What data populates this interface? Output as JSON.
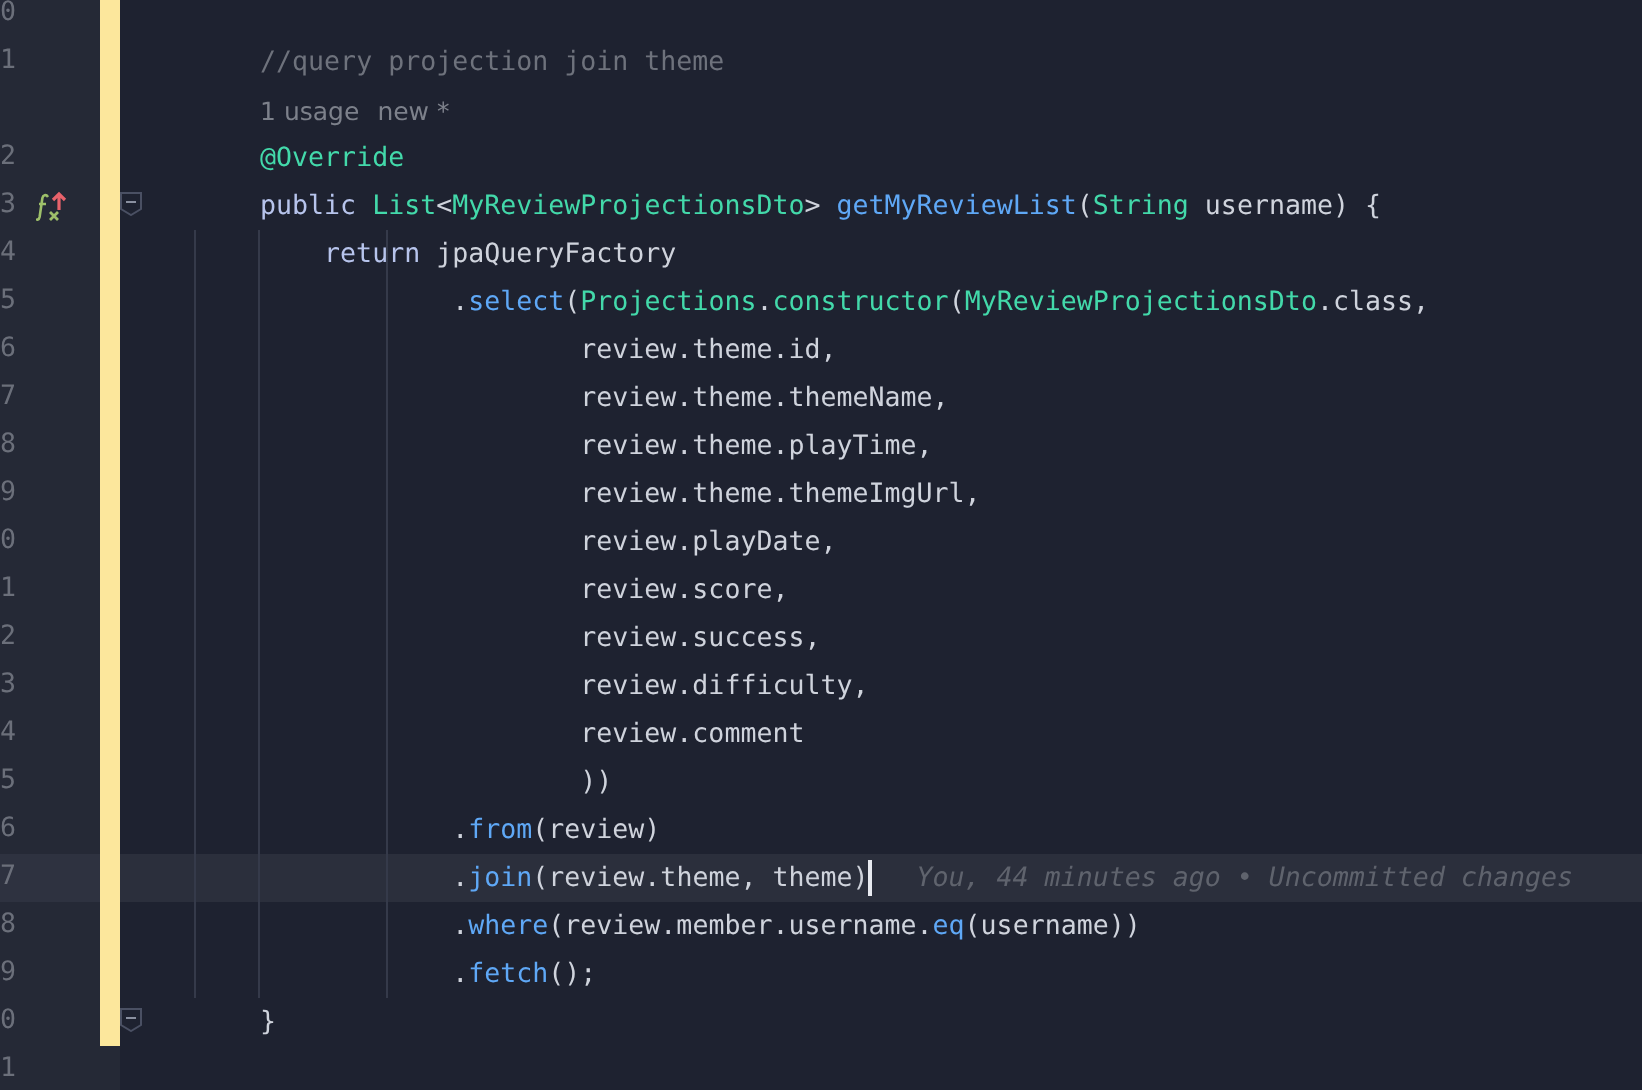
{
  "editor": {
    "lines": [
      {
        "kind": "code",
        "number": "0",
        "changed": true,
        "current": false,
        "fold": false,
        "overrides": false
      },
      {
        "kind": "code",
        "number": "1",
        "changed": true,
        "current": false,
        "fold": false,
        "overrides": false,
        "tokens": [
          {
            "kind": "comment",
            "text": "    //query projection join theme"
          }
        ]
      },
      {
        "kind": "hint",
        "changed": true,
        "current": false,
        "fold": false,
        "overrides": false,
        "parts": [
          "    1 usage",
          "new *"
        ]
      },
      {
        "kind": "code",
        "number": "2",
        "changed": true,
        "current": false,
        "fold": false,
        "overrides": false,
        "tokens": [
          {
            "kind": "annotation",
            "text": "    @Override"
          }
        ]
      },
      {
        "kind": "code",
        "number": "3",
        "changed": true,
        "current": false,
        "fold": true,
        "overrides": true,
        "tokens": [
          {
            "kind": "keyword",
            "text": "    public "
          },
          {
            "kind": "type",
            "text": "List"
          },
          {
            "kind": "plain",
            "text": "<"
          },
          {
            "kind": "type",
            "text": "MyReviewProjectionsDto"
          },
          {
            "kind": "plain",
            "text": "> "
          },
          {
            "kind": "method",
            "text": "getMyReviewList"
          },
          {
            "kind": "plain",
            "text": "("
          },
          {
            "kind": "type",
            "text": "String"
          },
          {
            "kind": "plain",
            "text": " username) {"
          }
        ]
      },
      {
        "kind": "code",
        "number": "4",
        "changed": true,
        "current": false,
        "fold": false,
        "overrides": false,
        "tokens": [
          {
            "kind": "keyword",
            "text": "        return "
          },
          {
            "kind": "plain",
            "text": "jpaQueryFactory"
          }
        ]
      },
      {
        "kind": "code",
        "number": "5",
        "changed": true,
        "current": false,
        "fold": false,
        "overrides": false,
        "tokens": [
          {
            "kind": "plain",
            "text": "                ."
          },
          {
            "kind": "method",
            "text": "select"
          },
          {
            "kind": "plain",
            "text": "("
          },
          {
            "kind": "type",
            "text": "Projections"
          },
          {
            "kind": "plain",
            "text": "."
          },
          {
            "kind": "type",
            "text": "constructor"
          },
          {
            "kind": "plain",
            "text": "("
          },
          {
            "kind": "type",
            "text": "MyReviewProjectionsDto"
          },
          {
            "kind": "plain",
            "text": ".class,"
          }
        ]
      },
      {
        "kind": "code",
        "number": "6",
        "changed": true,
        "current": false,
        "fold": false,
        "overrides": false,
        "tokens": [
          {
            "kind": "plain",
            "text": "                        review.theme.id,"
          }
        ]
      },
      {
        "kind": "code",
        "number": "7",
        "changed": true,
        "current": false,
        "fold": false,
        "overrides": false,
        "tokens": [
          {
            "kind": "plain",
            "text": "                        review.theme.themeName,"
          }
        ]
      },
      {
        "kind": "code",
        "number": "8",
        "changed": true,
        "current": false,
        "fold": false,
        "overrides": false,
        "tokens": [
          {
            "kind": "plain",
            "text": "                        review.theme.playTime,"
          }
        ]
      },
      {
        "kind": "code",
        "number": "9",
        "changed": true,
        "current": false,
        "fold": false,
        "overrides": false,
        "tokens": [
          {
            "kind": "plain",
            "text": "                        review.theme.themeImgUrl,"
          }
        ]
      },
      {
        "kind": "code",
        "number": "0",
        "changed": true,
        "current": false,
        "fold": false,
        "overrides": false,
        "tokens": [
          {
            "kind": "plain",
            "text": "                        review.playDate,"
          }
        ]
      },
      {
        "kind": "code",
        "number": "1",
        "changed": true,
        "current": false,
        "fold": false,
        "overrides": false,
        "tokens": [
          {
            "kind": "plain",
            "text": "                        review.score,"
          }
        ]
      },
      {
        "kind": "code",
        "number": "2",
        "changed": true,
        "current": false,
        "fold": false,
        "overrides": false,
        "tokens": [
          {
            "kind": "plain",
            "text": "                        review.success,"
          }
        ]
      },
      {
        "kind": "code",
        "number": "3",
        "changed": true,
        "current": false,
        "fold": false,
        "overrides": false,
        "tokens": [
          {
            "kind": "plain",
            "text": "                        review.difficulty,"
          }
        ]
      },
      {
        "kind": "code",
        "number": "4",
        "changed": true,
        "current": false,
        "fold": false,
        "overrides": false,
        "tokens": [
          {
            "kind": "plain",
            "text": "                        review.comment"
          }
        ]
      },
      {
        "kind": "code",
        "number": "5",
        "changed": true,
        "current": false,
        "fold": false,
        "overrides": false,
        "tokens": [
          {
            "kind": "plain",
            "text": "                        ))"
          }
        ]
      },
      {
        "kind": "code",
        "number": "6",
        "changed": true,
        "current": false,
        "fold": false,
        "overrides": false,
        "tokens": [
          {
            "kind": "plain",
            "text": "                ."
          },
          {
            "kind": "method",
            "text": "from"
          },
          {
            "kind": "plain",
            "text": "(review)"
          }
        ]
      },
      {
        "kind": "code",
        "number": "7",
        "changed": true,
        "current": true,
        "fold": false,
        "overrides": false,
        "tokens": [
          {
            "kind": "plain",
            "text": "                ."
          },
          {
            "kind": "method",
            "text": "join"
          },
          {
            "kind": "plain",
            "text": "(review.theme, theme)"
          }
        ],
        "blame": "You, 44 minutes ago • Uncommitted changes"
      },
      {
        "kind": "code",
        "number": "8",
        "changed": true,
        "current": false,
        "fold": false,
        "overrides": false,
        "tokens": [
          {
            "kind": "plain",
            "text": "                ."
          },
          {
            "kind": "method",
            "text": "where"
          },
          {
            "kind": "plain",
            "text": "(review.member.username."
          },
          {
            "kind": "method",
            "text": "eq"
          },
          {
            "kind": "plain",
            "text": "(username))"
          }
        ]
      },
      {
        "kind": "code",
        "number": "9",
        "changed": true,
        "current": false,
        "fold": false,
        "overrides": false,
        "tokens": [
          {
            "kind": "plain",
            "text": "                ."
          },
          {
            "kind": "method",
            "text": "fetch"
          },
          {
            "kind": "plain",
            "text": "();"
          }
        ]
      },
      {
        "kind": "code",
        "number": "0",
        "changed": true,
        "current": false,
        "fold": true,
        "overrides": false,
        "tokens": [
          {
            "kind": "plain",
            "text": "    }"
          }
        ]
      },
      {
        "kind": "code",
        "number": "1",
        "changed": false,
        "current": false,
        "fold": false,
        "overrides": false
      }
    ]
  }
}
